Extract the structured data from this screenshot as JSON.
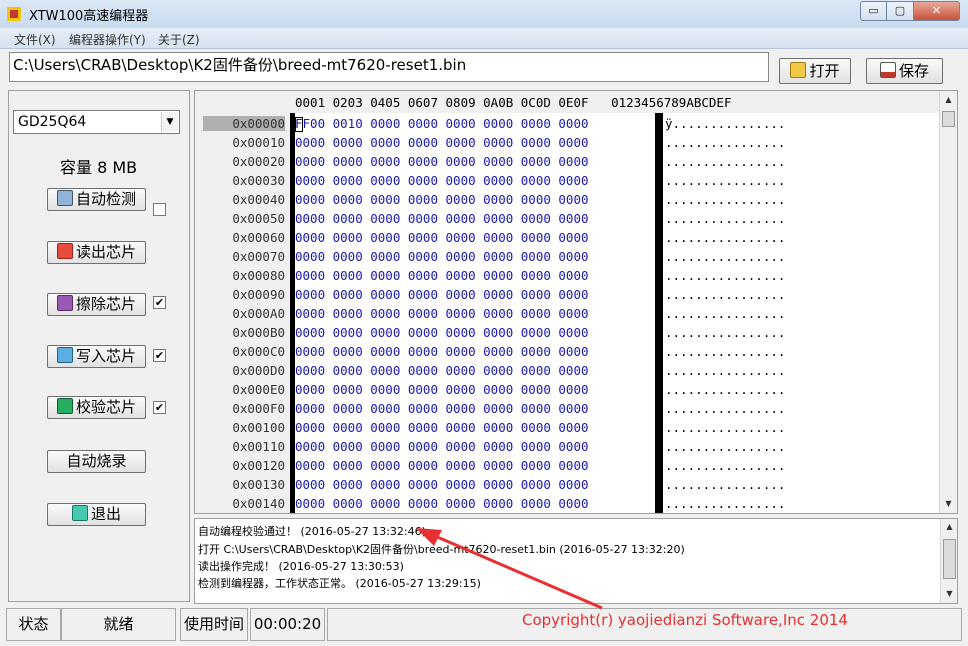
{
  "window": {
    "title": "XTW100高速编程器",
    "min_glyph": "▭",
    "max_glyph": "▢",
    "close_glyph": "✕"
  },
  "menu": {
    "items": [
      "文件(X)",
      "编程器操作(Y)",
      "关于(Z)"
    ]
  },
  "path": {
    "value": "C:\\Users\\CRAB\\Desktop\\K2固件备份\\breed-mt7620-reset1.bin"
  },
  "toolbar": {
    "open_label": "打开",
    "save_label": "保存"
  },
  "chip": {
    "selected": "GD25Q64",
    "capacity_label": "容量 8 MB"
  },
  "actions": {
    "auto_detect": "自动检测",
    "read_chip": "读出芯片",
    "erase_chip": "擦除芯片",
    "write_chip": "写入芯片",
    "verify_chip": "校验芯片",
    "auto_burn": "自动烧录",
    "exit": "退出",
    "auto_detect_checked": false,
    "erase_checked": true,
    "write_checked": true,
    "verify_checked": true,
    "check_glyph": "✔"
  },
  "hex": {
    "header": "0001 0203 0405 0607 0809 0A0B 0C0D 0E0F   0123456789ABCDEF",
    "addresses": [
      "0x00000",
      "0x00010",
      "0x00020",
      "0x00030",
      "0x00040",
      "0x00050",
      "0x00060",
      "0x00070",
      "0x00080",
      "0x00090",
      "0x000A0",
      "0x000B0",
      "0x000C0",
      "0x000D0",
      "0x000E0",
      "0x000F0",
      "0x00100",
      "0x00110",
      "0x00120",
      "0x00130",
      "0x00140"
    ],
    "rows": [
      "FF00 0010 0000 0000 0000 0000 0000 0000",
      "0000 0000 0000 0000 0000 0000 0000 0000",
      "0000 0000 0000 0000 0000 0000 0000 0000",
      "0000 0000 0000 0000 0000 0000 0000 0000",
      "0000 0000 0000 0000 0000 0000 0000 0000",
      "0000 0000 0000 0000 0000 0000 0000 0000",
      "0000 0000 0000 0000 0000 0000 0000 0000",
      "0000 0000 0000 0000 0000 0000 0000 0000",
      "0000 0000 0000 0000 0000 0000 0000 0000",
      "0000 0000 0000 0000 0000 0000 0000 0000",
      "0000 0000 0000 0000 0000 0000 0000 0000",
      "0000 0000 0000 0000 0000 0000 0000 0000",
      "0000 0000 0000 0000 0000 0000 0000 0000",
      "0000 0000 0000 0000 0000 0000 0000 0000",
      "0000 0000 0000 0000 0000 0000 0000 0000",
      "0000 0000 0000 0000 0000 0000 0000 0000",
      "0000 0000 0000 0000 0000 0000 0000 0000",
      "0000 0000 0000 0000 0000 0000 0000 0000",
      "0000 0000 0000 0000 0000 0000 0000 0000",
      "0000 0000 0000 0000 0000 0000 0000 0000",
      "0000 0000 0000 0000 0000 0000 0000 0000"
    ],
    "ascii": [
      "ÿ...............",
      "................",
      "................",
      "................",
      "................",
      "................",
      "................",
      "................",
      "................",
      "................",
      "................",
      "................",
      "................",
      "................",
      "................",
      "................",
      "................",
      "................",
      "................",
      "................",
      "................"
    ],
    "scroll_up": "▲",
    "scroll_down": "▼"
  },
  "log": {
    "lines": [
      "自动编程校验通过！ (2016-05-27 13:32:46)",
      "打开 C:\\Users\\CRAB\\Desktop\\K2固件备份\\breed-mt7620-reset1.bin (2016-05-27 13:32:20)",
      "读出操作完成！ (2016-05-27 13:30:53)",
      "检测到编程器，工作状态正常。 (2016-05-27 13:29:15)"
    ],
    "scroll_up": "▲",
    "scroll_down": "▼"
  },
  "status": {
    "state_label": "状态",
    "state_value": "就绪",
    "time_label": "使用时间",
    "time_value": "00:00:20",
    "copyright": "Copyright(r) yaojiedianzi Software,Inc 2014"
  },
  "colors": {
    "hex_text": "#1a1ab0",
    "annotation_arrow": "#e83030"
  }
}
